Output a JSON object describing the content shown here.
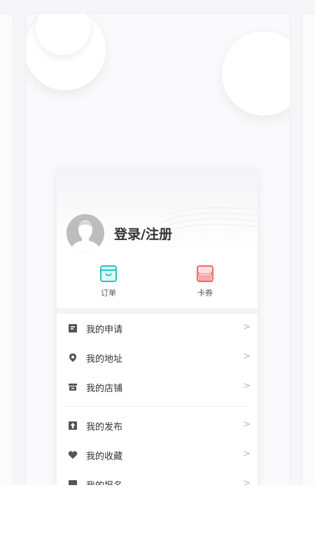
{
  "profile": {
    "login_label": "登录/注册"
  },
  "shortcuts": [
    {
      "label": "订单",
      "icon": "bag-icon",
      "color": "#2bc4c4"
    },
    {
      "label": "卡券",
      "icon": "coupon-icon",
      "color": "#ef6a6a"
    }
  ],
  "menu": [
    {
      "label": "我的申请",
      "icon": "document-icon"
    },
    {
      "label": "我的地址",
      "icon": "location-pin-icon"
    },
    {
      "label": "我的店铺",
      "icon": "store-icon"
    },
    {
      "label": "我的发布",
      "icon": "upload-icon"
    },
    {
      "label": "我的收藏",
      "icon": "heart-icon"
    },
    {
      "label": "我的报名",
      "icon": "signup-icon"
    }
  ],
  "colors": {
    "text": "#333333",
    "icon": "#555555",
    "arrow": "#b8b8b8"
  }
}
